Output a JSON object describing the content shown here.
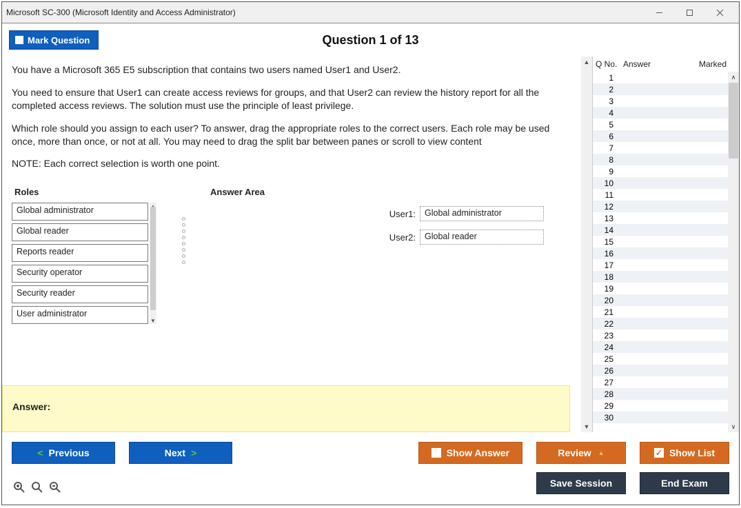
{
  "window": {
    "title": "Microsoft SC-300 (Microsoft Identity and Access Administrator)"
  },
  "header": {
    "mark_label": "Mark Question",
    "question_title": "Question 1 of 13"
  },
  "question": {
    "p1": "You have a Microsoft 365 E5 subscription that contains two users named User1 and User2.",
    "p2": "You need to ensure that User1 can create access reviews for groups, and that User2 can review the history report for all the completed access reviews. The solution must use the principle of least privilege.",
    "p3": "Which role should you assign to each user? To answer, drag the appropriate roles to the correct users. Each role may be used once, more than once, or not at all. You may need to drag the split bar between panes or scroll to view content",
    "p4": "NOTE: Each correct selection is worth one point.",
    "roles_header": "Roles",
    "answer_area_header": "Answer Area",
    "roles": [
      "Global administrator",
      "Global reader",
      "Reports reader",
      "Security operator",
      "Security reader",
      "User administrator"
    ],
    "drop_targets": [
      {
        "label": "User1:",
        "value": "Global administrator"
      },
      {
        "label": "User2:",
        "value": "Global reader"
      }
    ],
    "answer_label": "Answer:"
  },
  "sidebar": {
    "headers": {
      "qno": "Q No.",
      "answer": "Answer",
      "marked": "Marked"
    },
    "rows": 30
  },
  "buttons": {
    "previous": "Previous",
    "next": "Next",
    "show_answer": "Show Answer",
    "review": "Review",
    "show_list": "Show List",
    "save_session": "Save Session",
    "end_exam": "End Exam"
  }
}
